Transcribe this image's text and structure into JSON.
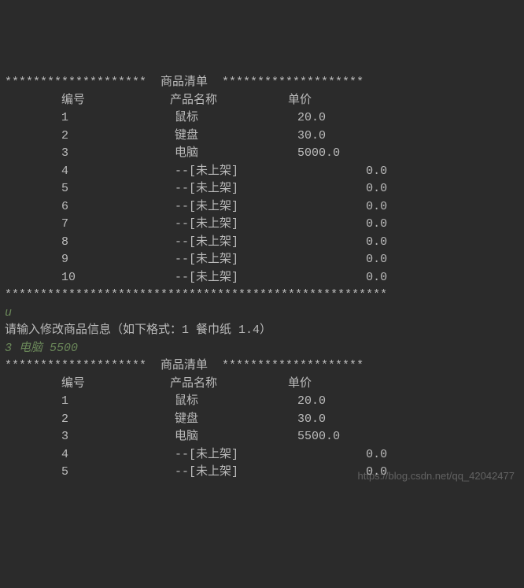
{
  "section1": {
    "header_stars_left": "********************",
    "title": "  商品清单  ",
    "header_stars_right": "********************",
    "col_id": "编号",
    "col_name": "产品名称",
    "col_price": "单价",
    "rows": [
      {
        "id": "1",
        "name": "鼠标",
        "price": "20.0"
      },
      {
        "id": "2",
        "name": "键盘",
        "price": "30.0"
      },
      {
        "id": "3",
        "name": "电脑",
        "price": "5000.0"
      },
      {
        "id": "4",
        "name": "--[未上架]",
        "price": "0.0"
      },
      {
        "id": "5",
        "name": "--[未上架]",
        "price": "0.0"
      },
      {
        "id": "6",
        "name": "--[未上架]",
        "price": "0.0"
      },
      {
        "id": "7",
        "name": "--[未上架]",
        "price": "0.0"
      },
      {
        "id": "8",
        "name": "--[未上架]",
        "price": "0.0"
      },
      {
        "id": "9",
        "name": "--[未上架]",
        "price": "0.0"
      },
      {
        "id": "10",
        "name": "--[未上架]",
        "price": "0.0"
      }
    ],
    "footer_stars": "******************************************************"
  },
  "input1": "u",
  "prompt": "请输入修改商品信息（如下格式：1 餐巾纸 1.4）",
  "input2": "3 电脑 5500",
  "section2": {
    "header_stars_left": "********************",
    "title": "  商品清单  ",
    "header_stars_right": "********************",
    "col_id": "编号",
    "col_name": "产品名称",
    "col_price": "单价",
    "rows": [
      {
        "id": "1",
        "name": "鼠标",
        "price": "20.0"
      },
      {
        "id": "2",
        "name": "键盘",
        "price": "30.0"
      },
      {
        "id": "3",
        "name": "电脑",
        "price": "5500.0"
      },
      {
        "id": "4",
        "name": "--[未上架]",
        "price": "0.0"
      },
      {
        "id": "5",
        "name": "--[未上架]",
        "price": "0.0"
      }
    ]
  },
  "watermark": "https://blog.csdn.net/qq_42042477"
}
